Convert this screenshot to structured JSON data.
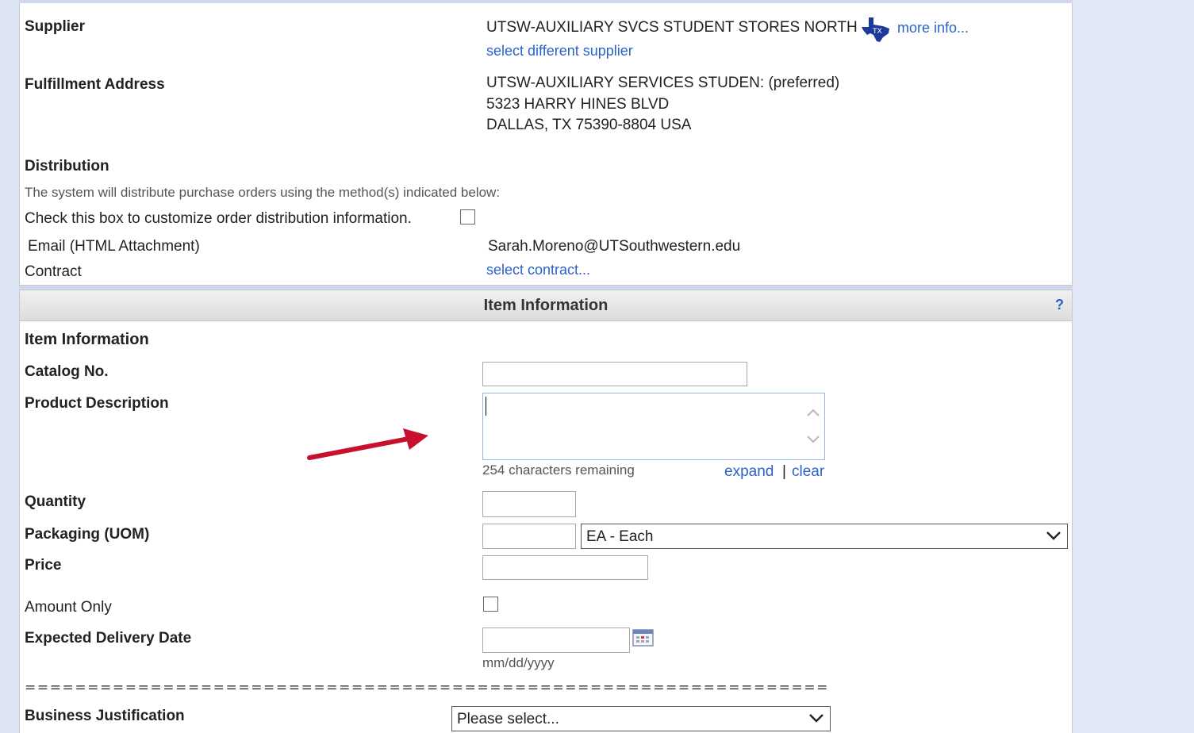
{
  "supplier": {
    "label": "Supplier",
    "name": "UTSW-AUXILIARY SVCS STUDENT STORES NORTH",
    "more_info_link": "more info...",
    "select_different_link": "select different supplier"
  },
  "fulfillment": {
    "label": "Fulfillment Address",
    "line1": "UTSW-AUXILIARY SERVICES STUDEN: (preferred)",
    "line2": "5323 HARRY HINES BLVD",
    "line3": "DALLAS, TX 75390-8804 USA"
  },
  "distribution": {
    "heading": "Distribution",
    "description": "The system will distribute purchase orders using the method(s) indicated below:",
    "customize_label": "Check this box to customize order distribution information.",
    "customize_checked": false,
    "email_label": "Email (HTML Attachment)",
    "email_value": "Sarah.Moreno@UTSouthwestern.edu",
    "contract_label": "Contract",
    "contract_link": "select contract..."
  },
  "item_section": {
    "header_title": "Item Information",
    "help_label": "?",
    "sub_heading": "Item Information",
    "catalog_label": "Catalog No.",
    "catalog_value": "",
    "product_desc_label": "Product Description",
    "product_desc_value": "",
    "chars_remaining": "254 characters remaining",
    "expand_link": "expand",
    "separator": "|",
    "clear_link": "clear",
    "quantity_label": "Quantity",
    "quantity_value": "",
    "packaging_label": "Packaging (UOM)",
    "packaging_qty_value": "",
    "uom_selected": "EA - Each",
    "price_label": "Price",
    "price_value": "",
    "amount_only_label": "Amount Only",
    "amount_only_checked": false,
    "delivery_label": "Expected Delivery Date",
    "delivery_value": "",
    "date_hint": "mm/dd/yyyy",
    "divider": "================================================================",
    "justification_label": "Business Justification",
    "justification_selected": "Please select..."
  },
  "colors": {
    "link": "#2a62c9",
    "annotation_arrow": "#c8102e",
    "texas_icon": "#1b3a9c"
  },
  "icons": [
    "texas-shape-icon",
    "help-icon",
    "chevron-up-icon",
    "chevron-down-icon",
    "calendar-icon",
    "annotation-arrow-icon"
  ]
}
